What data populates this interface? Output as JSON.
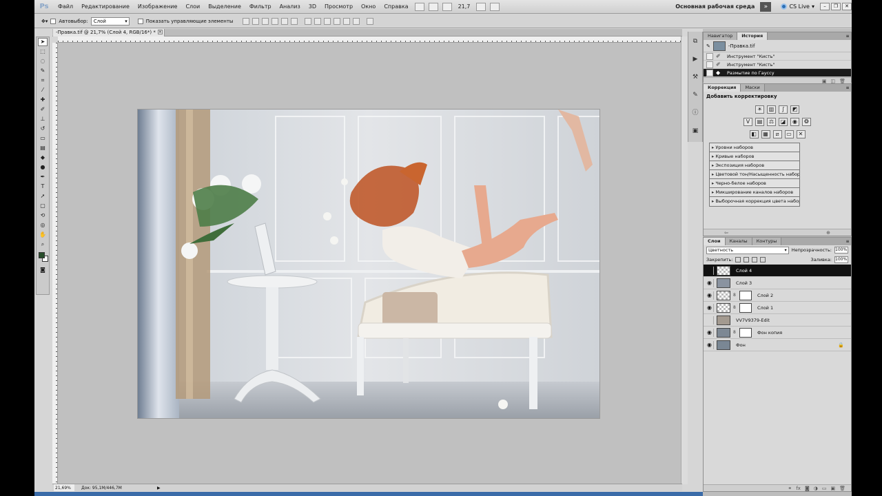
{
  "menubar": {
    "logo": "Ps",
    "items": [
      "Файл",
      "Редактирование",
      "Изображение",
      "Слои",
      "Выделение",
      "Фильтр",
      "Анализ",
      "3D",
      "Просмотр",
      "Окно",
      "Справка"
    ],
    "zoom": "21,7",
    "workspace": "Основная рабочая среда",
    "cslive": "CS Live"
  },
  "options": {
    "autoselect_label": "Автовыбор:",
    "autoselect_value": "Слой",
    "show_controls_label": "Показать управляющие элементы"
  },
  "document": {
    "tab_title": "-Правка.tif @ 21,7% (Слой 4, RGB/16*) *",
    "zoom_status": "21,69%",
    "doc_size": "Док: 95,1M/446,7M"
  },
  "history": {
    "tabs": [
      "Навигатор",
      "История"
    ],
    "snapshot": "-Правка.tif",
    "steps": [
      "Инструмент \"Кисть\"",
      "Инструмент \"Кисть\"",
      "Размытие по Гауссу"
    ]
  },
  "adjustments": {
    "tabs": [
      "Коррекция",
      "Маски"
    ],
    "title": "Добавить корректировку",
    "presets": [
      "Уровни наборов",
      "Кривые наборов",
      "Экспозиция наборов",
      "Цветовой тон/Насыщенность наборов",
      "Черно-белое наборов",
      "Микширование каналов наборов",
      "Выборочная коррекция цвета наборов"
    ]
  },
  "layers": {
    "tabs": [
      "Слои",
      "Каналы",
      "Контуры"
    ],
    "blend_mode": "Цветность",
    "opacity_label": "Непрозрачность:",
    "opacity": "100%",
    "lock_label": "Закрепить:",
    "fill_label": "Заливка:",
    "fill": "100%",
    "items": [
      {
        "name": "Слой 4",
        "visible": true,
        "selected": true,
        "mask": false
      },
      {
        "name": "Слой 3",
        "visible": true,
        "selected": false,
        "mask": false
      },
      {
        "name": "Слой 2",
        "visible": true,
        "selected": false,
        "mask": true
      },
      {
        "name": "Слой 1",
        "visible": true,
        "selected": false,
        "mask": true
      },
      {
        "name": "VV7V9379-Edit",
        "visible": false,
        "selected": false,
        "mask": false
      },
      {
        "name": "Фон копия",
        "visible": true,
        "selected": false,
        "mask": true
      },
      {
        "name": "Фон",
        "visible": true,
        "selected": false,
        "mask": false,
        "locked": true
      }
    ]
  },
  "colors": {
    "foreground": "#274d2a",
    "background": "#ffffff",
    "selection": "#111111"
  }
}
